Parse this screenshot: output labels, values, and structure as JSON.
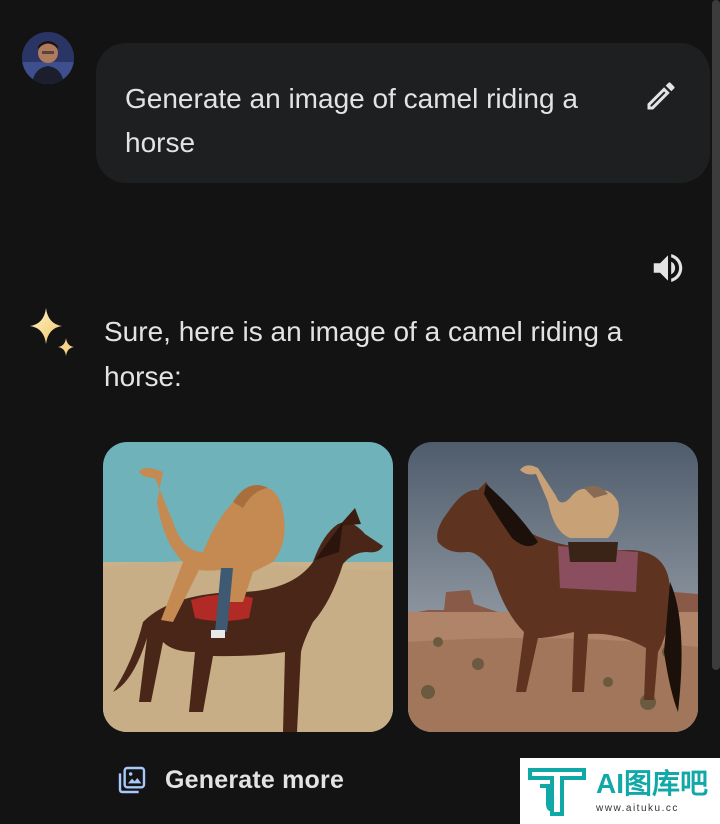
{
  "user": {
    "avatar_icon": "user-avatar",
    "prompt": "Generate an image of camel riding a horse",
    "edit_icon": "pencil-icon"
  },
  "response": {
    "speaker_icon": "volume-icon",
    "gemini_icon": "sparkle-icon",
    "text": "Sure, here is an image of a camel riding a horse:",
    "images": [
      {
        "subject": "camel riding a horse, teal sky, sandy ground"
      },
      {
        "subject": "camel riding a horse, desert with mesas"
      }
    ],
    "generate_more_label": "Generate more",
    "generate_more_icon": "image-stack-icon"
  },
  "watermark": {
    "title": "AI图库吧",
    "url": "www.aituku.cc"
  },
  "colors": {
    "background": "#131314",
    "bubble": "#1e1f20",
    "text": "#e3e3e3",
    "watermark_teal": "#11a8a8"
  }
}
